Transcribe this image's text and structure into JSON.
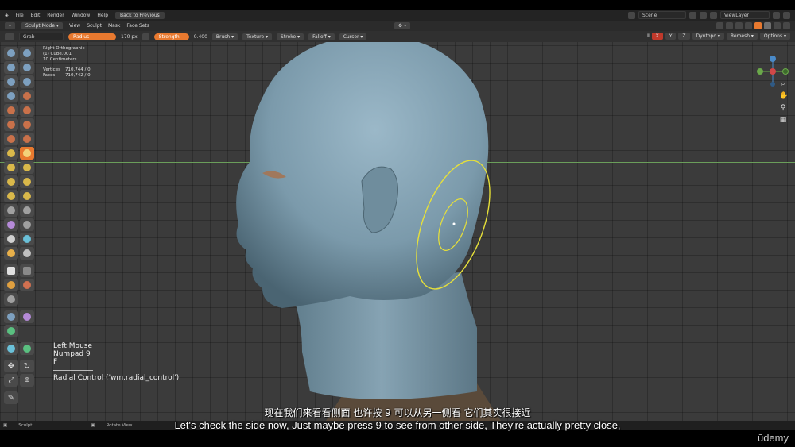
{
  "topbar": {
    "menus": [
      "File",
      "Edit",
      "Render",
      "Window",
      "Help"
    ],
    "back_button": "Back to Previous",
    "scene": "Scene",
    "view_layer": "ViewLayer"
  },
  "header": {
    "mode": "Sculpt Mode",
    "menus": [
      "View",
      "Sculpt",
      "Mask",
      "Face Sets"
    ]
  },
  "tool_settings": {
    "brush_name": "Grab",
    "radius_label": "Radius",
    "radius_value": "170 px",
    "strength_label": "Strength",
    "strength_value": "0.400",
    "dropdowns": [
      "Brush",
      "Texture",
      "Stroke",
      "Falloff",
      "Cursor"
    ],
    "right_dropdowns": [
      "Dyntopo",
      "Remesh",
      "Options"
    ],
    "symmetry": [
      "X",
      "Y",
      "Z"
    ]
  },
  "viewport_info": {
    "view": "Right Orthographic",
    "object": "(1) Cube.001",
    "scale": "10 Centimeters",
    "vertices_label": "Vertices",
    "vertices_value": "710,744 / 0",
    "faces_label": "Faces",
    "faces_value": "710,742 / 0"
  },
  "key_overlay": {
    "keys": [
      "Left Mouse",
      "Numpad 9",
      "F"
    ],
    "operator": "Radial Control ('wm.radial_control')"
  },
  "statusbar": {
    "left": "Sculpt",
    "middle": "Rotate View"
  },
  "subtitles": {
    "cn": "现在我们来看看侧面 也许按 9 可以从另一侧看 它们其实很接近",
    "en": "Let's check the side now, Just maybe press 9 to see from other side, They're actually pretty close,"
  },
  "brand": "ūdemy",
  "colors": {
    "accent_orange": "#e8792f",
    "brush_circle": "#e6e03a",
    "mesh": "#7f9fb0",
    "axis_green": "#6a9e5a"
  }
}
